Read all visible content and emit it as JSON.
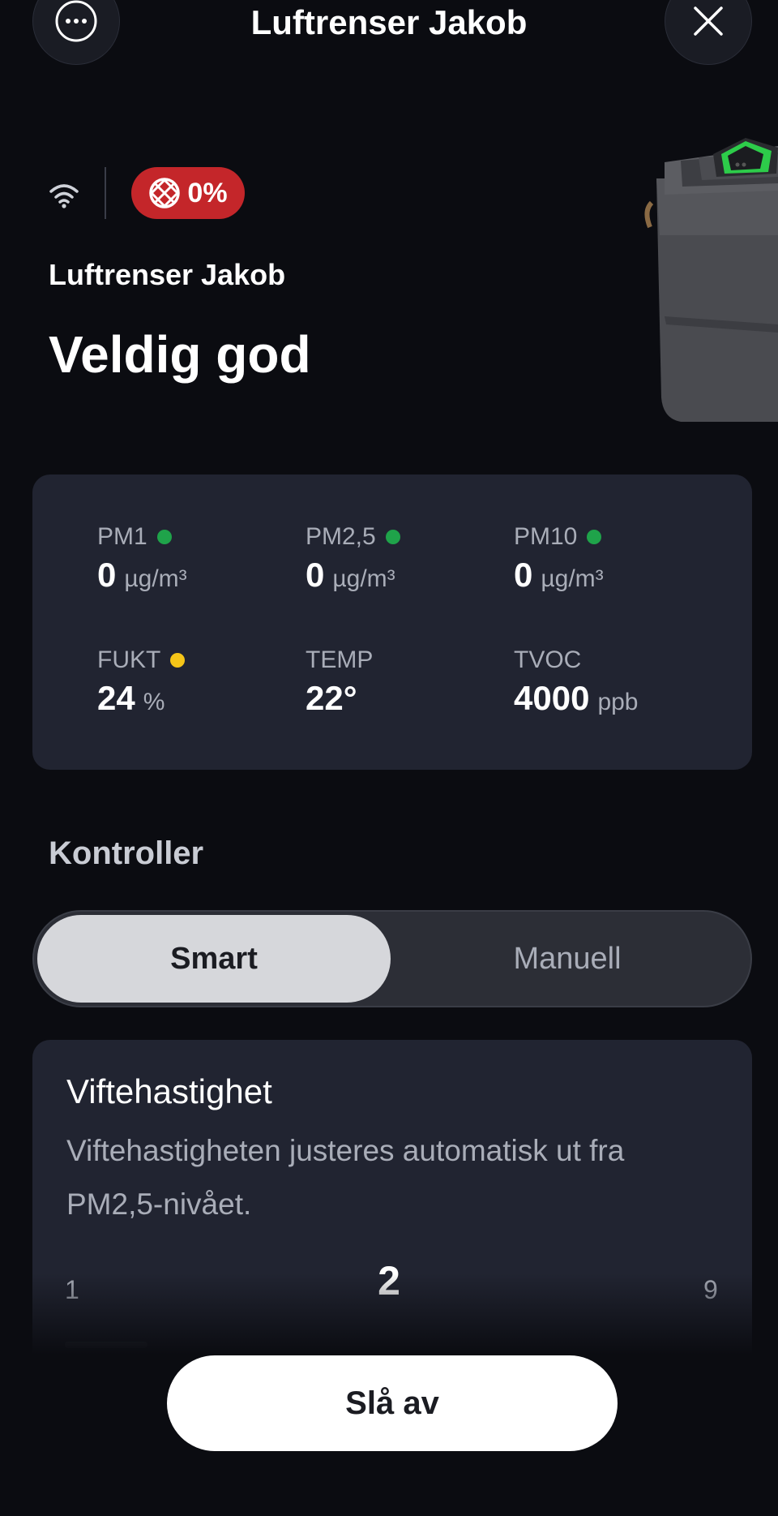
{
  "header": {
    "title": "Luftrenser Jakob",
    "menu_icon": "more-horizontal-icon",
    "close_icon": "close-icon"
  },
  "status": {
    "wifi_icon": "wifi-icon",
    "filter_icon": "filter-icon",
    "filter_level": "0%",
    "filter_color": "#c4262a"
  },
  "device": {
    "name": "Luftrenser Jakob",
    "air_quality": "Veldig god"
  },
  "metrics": [
    {
      "label": "PM1",
      "value": "0",
      "unit": "µg/m³",
      "status_color": "#1fa34a"
    },
    {
      "label": "PM2,5",
      "value": "0",
      "unit": "µg/m³",
      "status_color": "#1fa34a"
    },
    {
      "label": "PM10",
      "value": "0",
      "unit": "µg/m³",
      "status_color": "#1fa34a"
    },
    {
      "label": "FUKT",
      "value": "24",
      "unit": "%",
      "status_color": "#f5c518"
    },
    {
      "label": "TEMP",
      "value": "22°",
      "unit": "",
      "status_color": ""
    },
    {
      "label": "TVOC",
      "value": "4000",
      "unit": "ppb",
      "status_color": ""
    }
  ],
  "controls": {
    "title": "Kontroller",
    "modes": [
      "Smart",
      "Manuell"
    ],
    "selected_mode": "Smart"
  },
  "fan": {
    "title": "Viftehastighet",
    "description": "Viftehastigheten justeres automatisk ut fra PM2,5-nivået.",
    "min": "1",
    "value": "2",
    "max": "9"
  },
  "actions": {
    "turn_off": "Slå av"
  }
}
